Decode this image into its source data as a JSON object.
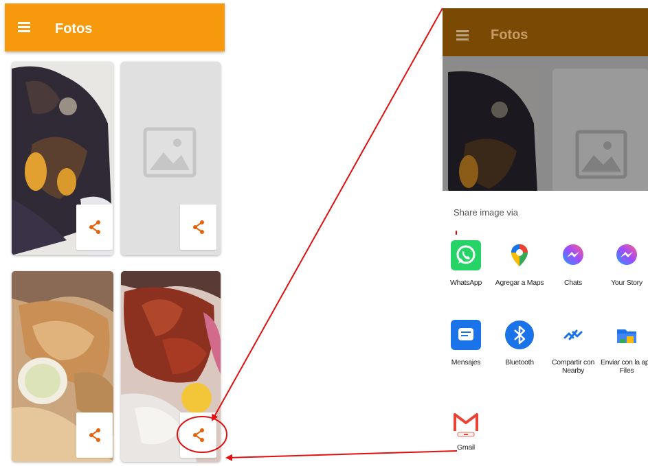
{
  "left_screen": {
    "app_title": "Fotos",
    "cards": [
      {
        "kind": "photo-food-1"
      },
      {
        "kind": "placeholder"
      },
      {
        "kind": "photo-food-2"
      },
      {
        "kind": "photo-food-3"
      }
    ]
  },
  "right_screen": {
    "app_title": "Fotos",
    "share_sheet": {
      "title": "Share image via",
      "apps": [
        {
          "label": "WhatsApp",
          "icon": "whatsapp-icon",
          "color": "#25d366"
        },
        {
          "label": "Agregar a Maps",
          "icon": "maps-pin-icon",
          "color": "#ea4335"
        },
        {
          "label": "Chats",
          "icon": "messenger-icon",
          "color": "#7b5cff"
        },
        {
          "label": "Your Story",
          "icon": "messenger-icon",
          "color": "#7b5cff"
        },
        {
          "label": "Mensajes",
          "icon": "messages-icon",
          "color": "#1a73e8"
        },
        {
          "label": "Bluetooth",
          "icon": "bluetooth-icon",
          "color": "#1a73e8"
        },
        {
          "label": "Compartir con Nearby",
          "icon": "nearby-icon",
          "color": "#1a73e8"
        },
        {
          "label": "Enviar con la app Files",
          "icon": "files-icon",
          "color": "#1a73e8"
        },
        {
          "label": "Gmail",
          "icon": "gmail-icon",
          "color": "#ea4335"
        }
      ]
    }
  },
  "colors": {
    "app_bar": "#f7990c",
    "share_icon": "#e8620c",
    "annotation": "#e01010"
  }
}
